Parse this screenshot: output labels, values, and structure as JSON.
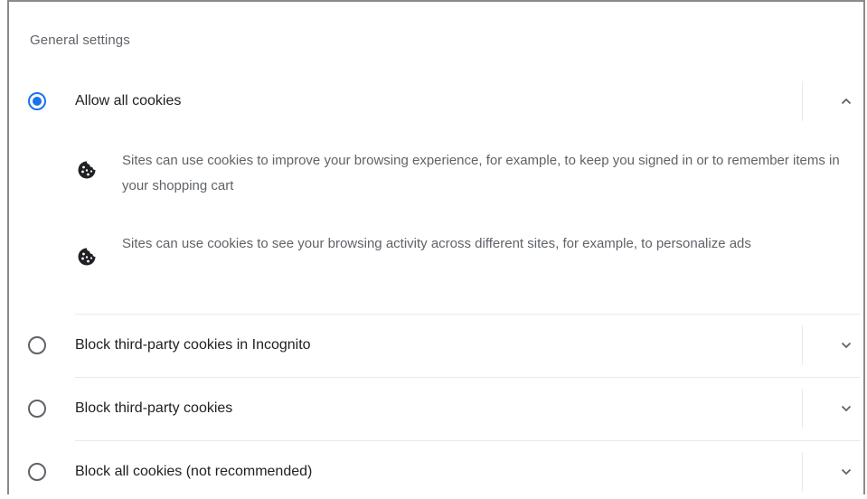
{
  "section": {
    "title": "General settings"
  },
  "options": [
    {
      "label": "Allow all cookies",
      "selected": true,
      "expanded": true,
      "chevron_icon": "chevron-up-icon"
    },
    {
      "label": "Block third-party cookies in Incognito",
      "selected": false,
      "expanded": false,
      "chevron_icon": "chevron-down-icon"
    },
    {
      "label": "Block third-party cookies",
      "selected": false,
      "expanded": false,
      "chevron_icon": "chevron-down-icon"
    },
    {
      "label": "Block all cookies (not recommended)",
      "selected": false,
      "expanded": false,
      "chevron_icon": "chevron-down-icon"
    }
  ],
  "details": [
    {
      "icon": "cookie-icon",
      "text": "Sites can use cookies to improve your browsing experience, for example, to keep you signed in or to remember items in your shopping cart"
    },
    {
      "icon": "cookie-icon",
      "text": "Sites can use cookies to see your browsing activity across different sites, for example, to personalize ads"
    }
  ],
  "colors": {
    "accent": "#1a73e8",
    "text_primary": "#202124",
    "text_secondary": "#5f6368",
    "divider": "#e8eaed"
  }
}
